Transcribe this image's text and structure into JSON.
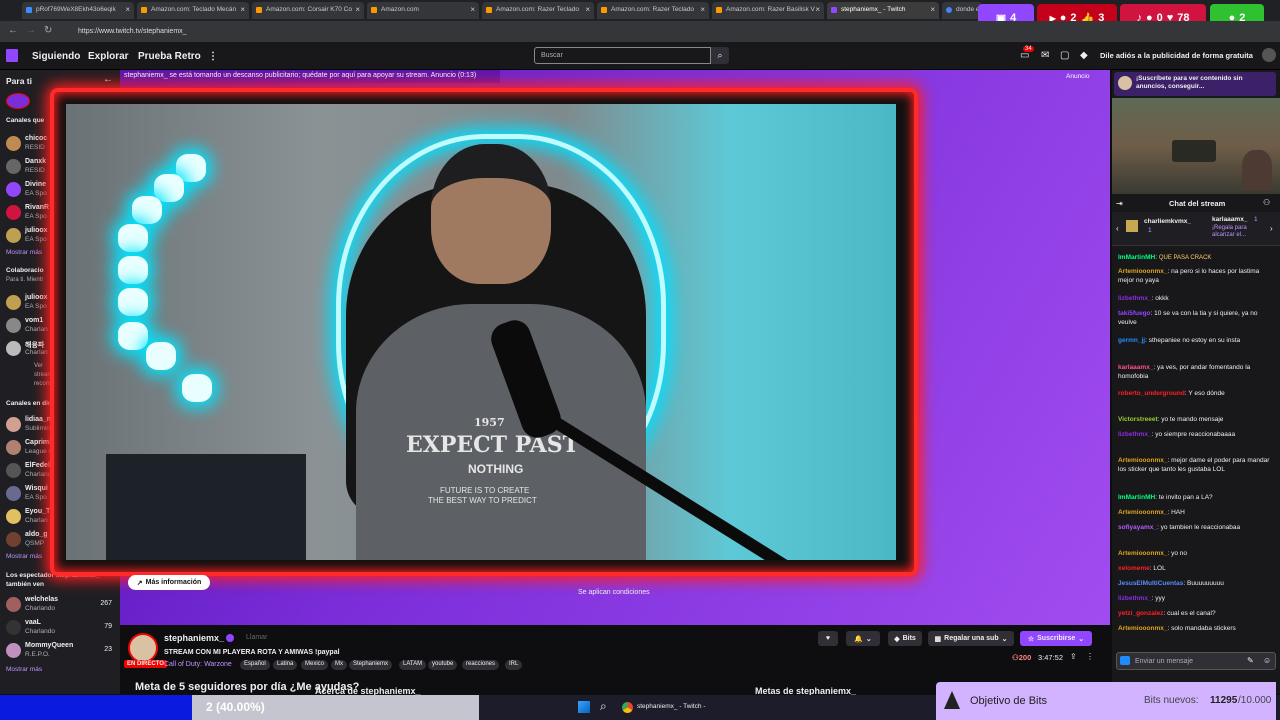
{
  "browser": {
    "tabs": [
      {
        "label": "pRof769WeX8Ekh43o6eqik"
      },
      {
        "label": "Amazon.com: Teclado Mecán"
      },
      {
        "label": "Amazon.com: Corsair K70 Co"
      },
      {
        "label": "Amazon.com"
      },
      {
        "label": "Amazon.com: Razer Teclado"
      },
      {
        "label": "Amazon.com: Razer Teclado"
      },
      {
        "label": "Amazon.com: Razer Basilisk V"
      },
      {
        "label": "stephaniemx_ - Twitch"
      },
      {
        "label": "donde e"
      }
    ],
    "url": "https://www.twitch.tv/stephaniemx_",
    "ext_counts": [
      "4",
      "2",
      "3",
      "0",
      "78",
      "2"
    ]
  },
  "nav": {
    "following": "Siguiendo",
    "explore": "Explorar",
    "retro": "Prueba Retro",
    "more": "⋮",
    "search_placeholder": "Buscar",
    "notif_count": "34",
    "ad_free": "Dile adiós a la publicidad de forma gratuita"
  },
  "sidebar": {
    "for_you": "Para ti",
    "collapse": "←",
    "following_title": "Canales que",
    "following": [
      {
        "name": "chicoc",
        "game": "RESID"
      },
      {
        "name": "Danxk",
        "game": "RESID"
      },
      {
        "name": "Divine",
        "game": "EA Spo"
      },
      {
        "name": "RivanR",
        "game": "EA Spo"
      },
      {
        "name": "julioox",
        "game": "EA Spo"
      }
    ],
    "show_more_1": "Mostrar más",
    "collab_title": "Colaboracio",
    "collab_sub": "Para ti. Mientr",
    "collab": [
      {
        "name": "julioox",
        "game": "EA Spo"
      },
      {
        "name": "vom1",
        "game": "Charlan"
      },
      {
        "name": "해융파",
        "game": "Charlan"
      }
    ],
    "collab_note": "Ver stream recom",
    "live_title": "Canales en dire",
    "live": [
      {
        "name": "lidiaa_mo",
        "game": "Sublimina"
      },
      {
        "name": "Caprimin",
        "game": "League o"
      },
      {
        "name": "ElFedelo",
        "game": "Charland"
      },
      {
        "name": "Wisqui",
        "game": "EA Spo"
      },
      {
        "name": "Eyou_T",
        "game": "Charlan"
      },
      {
        "name": "aldo_g",
        "game": "QSMP"
      }
    ],
    "show_more_2": "Mostrar más",
    "viewers_title": "Los espectador stephaniemx_ también ven",
    "viewers": [
      {
        "name": "welchelas",
        "game": "Charlando",
        "count": "267"
      },
      {
        "name": "vaaL",
        "game": "Charlando",
        "count": "79"
      },
      {
        "name": "MommyQueen",
        "game": "R.E.P.O.",
        "count": "23"
      }
    ],
    "show_more_3": "Mostrar más"
  },
  "player": {
    "ad_banner": "stephaniemx_ se está tomando un descanso publicitario; quédate por aquí para apoyar su stream. Anuncio (0:13)",
    "ad_badge": "Anuncio",
    "more_info": "Más información",
    "conditions": "Se aplican condiciones",
    "shirt_top": "1957",
    "shirt_main": "EXPECT PAST",
    "shirt_sub": "NOTHING",
    "shirt_line1": "FUTURE IS TO CREATE",
    "shirt_line2": "THE BEST WAY TO PREDICT"
  },
  "stream": {
    "channel": "stephaniemx_",
    "title": "STREAM CON MI PLAYERA ROTA Y AMIWAS !paypal",
    "live_badge": "EN DIRECTO",
    "game": "Call of Duty: Warzone",
    "tags": [
      "Español",
      "Latina",
      "Mexico",
      "Mx",
      "Stephaniemx",
      "LATAM",
      "youtube",
      "reacciones",
      "IRL"
    ],
    "bits_label": "Bits",
    "gift_label": "Regalar una sub",
    "subscribe_label": "Suscribirse",
    "viewers": "200",
    "uptime": "3:47:52",
    "goal": "Meta de 5 seguidores por día ¿Me ayudas?",
    "about": "Acerca de stephaniemx_",
    "goals_right": "Metas de stephaniemx_",
    "notify_label": "Llamar"
  },
  "chat": {
    "promo": "¡Suscríbete para ver contenido sin anuncios, conseguir...",
    "title": "Chat del stream",
    "gifter1": "charliemkvmx_",
    "gifter1_count": "1",
    "gifter2": "karlaaamx_",
    "gifter2_count": "1",
    "gifter2_note": "¡Regala para alcanzar el...",
    "messages": [
      {
        "user": "ImMartinMH",
        "color": "#00ff7f",
        "text": "QUE PASA CRACK"
      },
      {
        "user": "Artemiooonmx_",
        "color": "#daa520",
        "text": "na pero si lo haces por lastima mejor no yaya"
      },
      {
        "user": "lizbethmx_",
        "color": "#8a2be2",
        "text": "okkk"
      },
      {
        "user": "taki5fuego",
        "color": "#9146ff",
        "text": "10 se va con la tia y si quiere, ya no veulve"
      },
      {
        "user": "germn_jj",
        "color": "#1e90ff",
        "text": "sthepaniee no estoy en su insta"
      },
      {
        "user": "karlaaamx_",
        "color": "#ff4f8b",
        "text": "ya ves, por andar fomentando la homofobia"
      },
      {
        "user": "roberto_underground",
        "color": "#ff2020",
        "text": "Y eso dónde"
      },
      {
        "user": "Victorstreeet",
        "color": "#9acd32",
        "text": "yo te mando mensaje"
      },
      {
        "user": "lizbethmx_",
        "color": "#8a2be2",
        "text": "yo siempre reaccionabaaaa"
      },
      {
        "user": "Artemiooonmx_",
        "color": "#daa520",
        "text": "mejor dame el poder para mandar los sticker que tanto les gustaba LOL"
      },
      {
        "user": "ImMartinMH",
        "color": "#00ff7f",
        "text": "te invito pan a LA?"
      },
      {
        "user": "Artemiooonmx_",
        "color": "#daa520",
        "text": "HAH"
      },
      {
        "user": "sofiyayamx_",
        "color": "#b65cff",
        "text": "yo tambien le reaccionabaa"
      },
      {
        "user": "Artemiooonmx_",
        "color": "#daa520",
        "text": "yo no"
      },
      {
        "user": "xelomeme",
        "color": "#ff2020",
        "text": "LOL"
      },
      {
        "user": "JesusElMultiCuentas",
        "color": "#5b8cff",
        "text": "Buuuuuuuuu"
      },
      {
        "user": "lizbethmx_",
        "color": "#8a2be2",
        "text": "yyy"
      },
      {
        "user": "yetzi_gonzalez",
        "color": "#ff2020",
        "text": "cual es el canal?"
      },
      {
        "user": "Artemiooonmx_",
        "color": "#daa520",
        "text": "solo mandaba stickers"
      }
    ],
    "input_placeholder": "Enviar un mensaje"
  },
  "bits_goal": {
    "title": "Objetivo de Bits",
    "label": "Bits nuevos:",
    "current": "11295",
    "target": "/10.000"
  },
  "taskbar": {
    "progress_text": "2 (40.00%)",
    "progress_fraction": 0.4,
    "window_label": "stephaniemx_ - Twitch -"
  },
  "colors": {
    "twitch_purple": "#9146ff",
    "live_red": "#eb0400",
    "frame_red": "#ff2a2a"
  }
}
